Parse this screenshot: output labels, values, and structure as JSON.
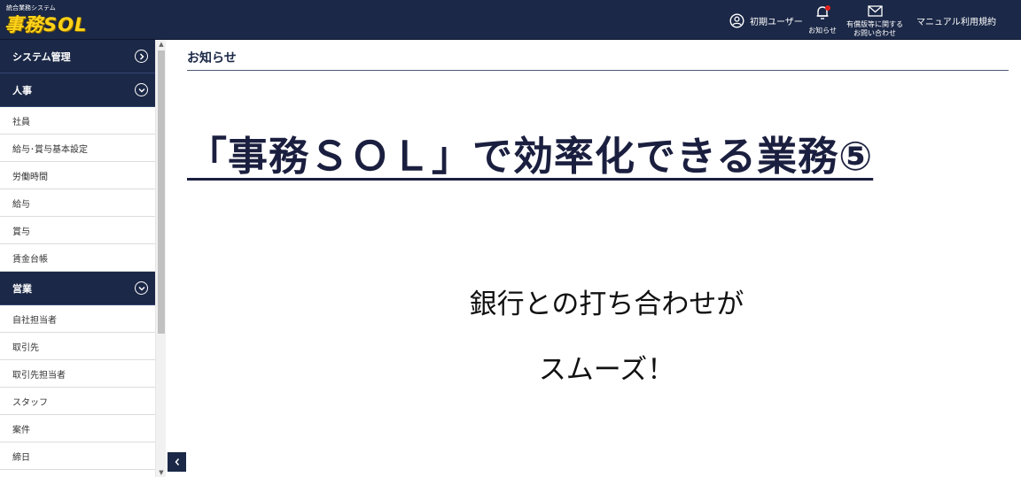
{
  "header": {
    "logo_sub": "統合業務システム",
    "logo_main": "事務SOL",
    "user_label": "初期ユーザー",
    "notice_label": "お知らせ",
    "inquiry_label": "有償版等に関する\nお問い合わせ",
    "manual_label": "マニュアル",
    "terms_label": "利用規約"
  },
  "sidebar": {
    "sections": [
      {
        "title": "システム管理",
        "state": "collapsed"
      },
      {
        "title": "人事",
        "state": "expanded",
        "items": [
          "社員",
          "給与･賞与基本設定",
          "労働時間",
          "給与",
          "賞与",
          "賃金台帳"
        ]
      },
      {
        "title": "営業",
        "state": "expanded",
        "items": [
          "自社担当者",
          "取引先",
          "取引先担当者",
          "スタッフ",
          "案件",
          "締日"
        ]
      }
    ]
  },
  "main": {
    "page_title": "お知らせ",
    "headline": "「事務ＳＯＬ」で効率化できる業務⑤",
    "line1": "銀行との打ち合わせが",
    "line2": "スムーズ！"
  },
  "colors": {
    "navy": "#1b2847",
    "logo_yellow": "#ffd21a",
    "notification_dot": "#e0211b"
  }
}
